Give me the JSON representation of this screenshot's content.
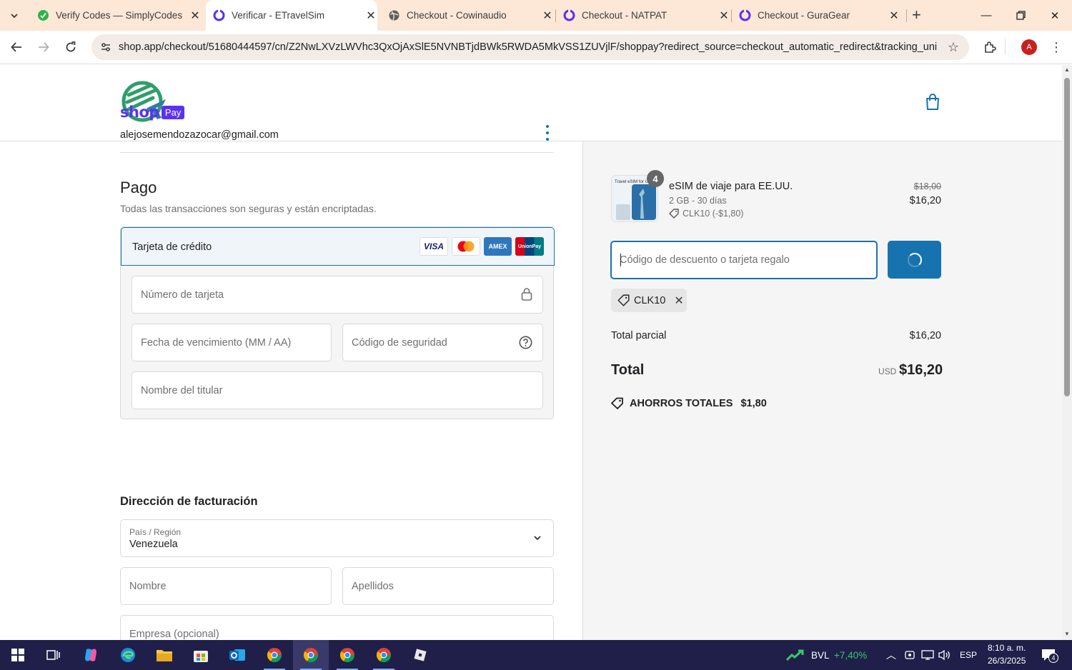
{
  "browser": {
    "tabs": [
      {
        "title": "Verify Codes — SimplyCodes",
        "active": false
      },
      {
        "title": "Verificar - ETravelSim",
        "active": true
      },
      {
        "title": "Checkout - Cowinaudio",
        "active": false
      },
      {
        "title": "Checkout - NATPAT",
        "active": false
      },
      {
        "title": "Checkout - GuraGear",
        "active": false
      }
    ],
    "url": "shop.app/checkout/51680444597/cn/Z2NwLXVzLWVhc3QxOjAxSlE5NVNBTjdBWk5RWDA5MkVSS1ZUVjlF/shoppay?redirect_source=checkout_automatic_redirect&tracking_uniq...",
    "profile_initial": "A"
  },
  "checkout": {
    "brand_word": "shop",
    "pay_badge": "Pay",
    "email": "alejosemendozazocar@gmail.com",
    "payment_heading": "Pago",
    "payment_subtitle": "Todas las transacciones son seguras y están encriptadas.",
    "card_option_label": "Tarjeta de crédito",
    "card_brands": [
      "VISA",
      "Mastercard",
      "AMEX",
      "UnionPay"
    ],
    "card_number_placeholder": "Número de tarjeta",
    "expiry_placeholder": "Fecha de vencimiento (MM / AA)",
    "cvv_placeholder": "Código de seguridad",
    "name_placeholder": "Nombre del titular",
    "billing_heading": "Dirección de facturación",
    "country_label": "País / Región",
    "country_value": "Venezuela",
    "first_name_placeholder": "Nombre",
    "last_name_placeholder": "Apellidos",
    "company_placeholder": "Empresa (opcional)"
  },
  "summary": {
    "item": {
      "thumb_text": "Travel eSIM for USA",
      "quantity": "4",
      "name": "eSIM de viaje para EE.UU.",
      "variant": "2 GB - 30 días",
      "discount": "CLK10 (-$1,80)",
      "price_original": "$18,00",
      "price_final": "$16,20"
    },
    "discount_placeholder": "Código de descuento o tarjeta regalo",
    "applied_code": "CLK10",
    "subtotal_label": "Total parcial",
    "subtotal_value": "$16,20",
    "total_label": "Total",
    "total_currency": "USD",
    "total_value": "$16,20",
    "savings_label": "AHORROS TOTALES",
    "savings_value": "$1,80"
  },
  "taskbar": {
    "stock_ticker": "BVL",
    "stock_change": "+7,40%",
    "language": "ESP",
    "time": "8:10 a. m.",
    "date": "26/3/2025",
    "notifications": "4"
  },
  "colors": {
    "shop_purple": "#5a31f4",
    "accent_blue": "#1773b0",
    "tab_strip": "#fde7d6",
    "taskbar": "#1f1f4a"
  }
}
